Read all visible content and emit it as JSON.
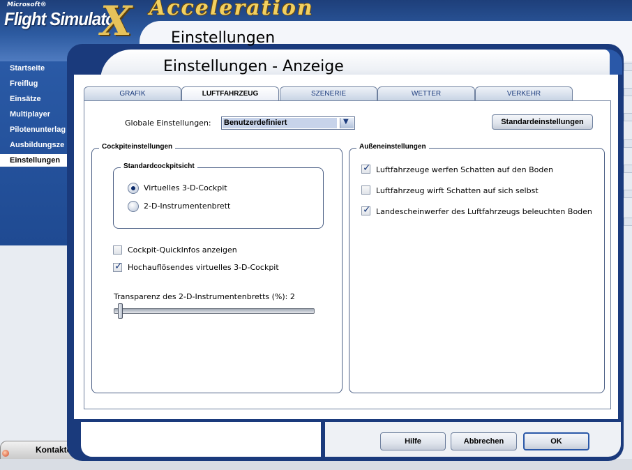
{
  "app": {
    "logo_microsoft": "Microsoft®",
    "logo_flight_simulator": "Flight Simulator",
    "logo_x": "X",
    "logo_acceleration": "Acceleration",
    "page_title": "Einstellungen"
  },
  "sidebar": {
    "items": [
      {
        "label": "Startseite"
      },
      {
        "label": "Freiflug"
      },
      {
        "label": "Einsätze"
      },
      {
        "label": "Multiplayer"
      },
      {
        "label": "Pilotenunterlag"
      },
      {
        "label": "Ausbildungsze"
      },
      {
        "label": "Einstellungen",
        "active": true
      }
    ]
  },
  "kontakte": {
    "label": "Kontakte"
  },
  "dialog": {
    "title": "Einstellungen - Anzeige",
    "tabs": [
      {
        "label": "GRAFIK"
      },
      {
        "label": "LUFTFAHRZEUG",
        "active": true
      },
      {
        "label": "SZENERIE"
      },
      {
        "label": "WETTER"
      },
      {
        "label": "VERKEHR"
      }
    ],
    "global_label": "Globale Einstellungen:",
    "global_value": "Benutzerdefiniert",
    "defaults_button": "Standardeinstellungen",
    "cockpit": {
      "title": "Cockpiteinstellungen",
      "view_group_title": "Standardcockpitsicht",
      "options": [
        {
          "label": "Virtuelles 3-D-Cockpit",
          "selected": true
        },
        {
          "label": "2-D-Instrumentenbrett",
          "selected": false
        }
      ],
      "checks": [
        {
          "label": "Cockpit-QuickInfos anzeigen",
          "checked": false
        },
        {
          "label": "Hochauflösendes virtuelles 3-D-Cockpit",
          "checked": true
        }
      ],
      "transparency_label": "Transparenz des 2-D-Instrumentenbretts (%): 2",
      "transparency_value": 2
    },
    "exterior": {
      "title": "Außeneinstellungen",
      "checks": [
        {
          "label": "Luftfahrzeuge werfen Schatten auf den Boden",
          "checked": true
        },
        {
          "label": "Luftfahrzeug wirft Schatten auf sich selbst",
          "checked": false
        },
        {
          "label": "Landescheinwerfer des Luftfahrzeugs beleuchten Boden",
          "checked": true
        }
      ]
    },
    "buttons": {
      "help": "Hilfe",
      "cancel": "Abbrechen",
      "ok": "OK"
    }
  },
  "colors": {
    "dialog_frame": "#1a3a7c",
    "sidebar": "#2a5aa6",
    "accent": "#2a58a8"
  }
}
